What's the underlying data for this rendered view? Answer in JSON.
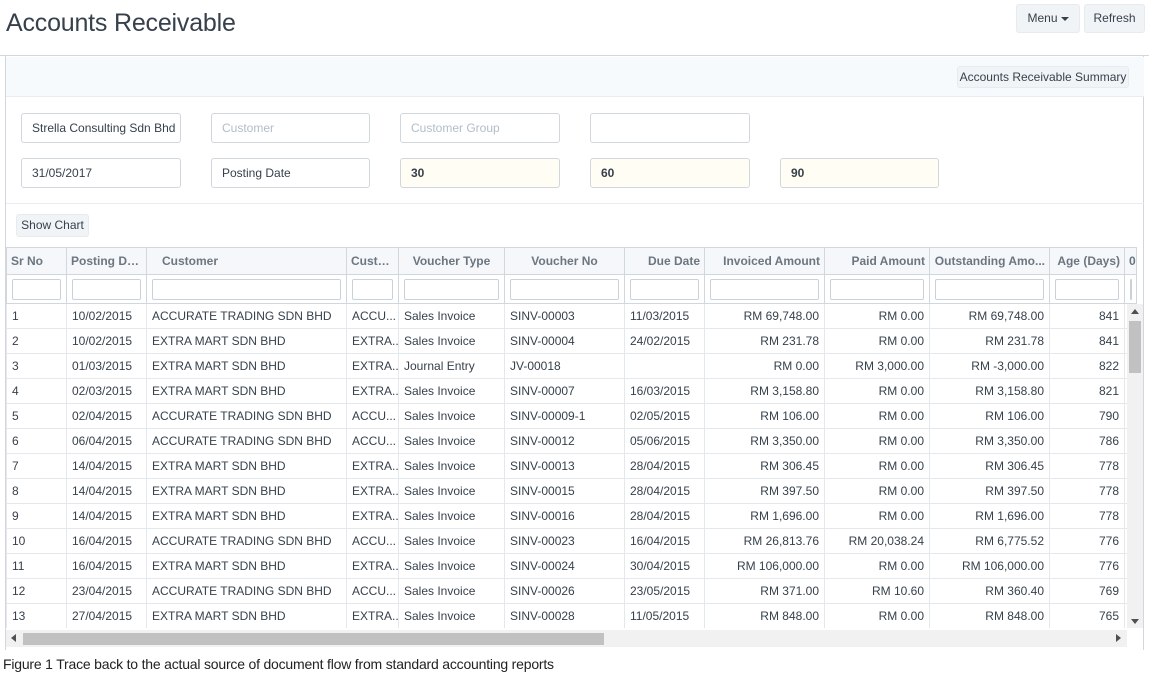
{
  "header": {
    "title": "Accounts Receivable",
    "menu_label": "Menu",
    "refresh_label": "Refresh"
  },
  "toolbar": {
    "summary_label": "Accounts Receivable Summary",
    "show_chart_label": "Show Chart"
  },
  "filters": {
    "company": "Strella Consulting Sdn Bhd",
    "customer_placeholder": "Customer",
    "customer_group_placeholder": "Customer Group",
    "date": "31/05/2017",
    "posting_date": "Posting Date",
    "range1": "30",
    "range2": "60",
    "range3": "90"
  },
  "columns": [
    "Sr No",
    "Posting Da...",
    "Customer",
    "Custo...",
    "Voucher Type",
    "Voucher No",
    "Due Date",
    "Invoiced Amount",
    "Paid Amount",
    "Outstanding Amo...",
    "Age (Days)",
    "0"
  ],
  "rows": [
    [
      "1",
      "10/02/2015",
      "ACCURATE TRADING SDN BHD",
      "ACCU...",
      "Sales Invoice",
      "SINV-00003",
      "11/03/2015",
      "RM 69,748.00",
      "RM 0.00",
      "RM 69,748.00",
      "841"
    ],
    [
      "2",
      "10/02/2015",
      "EXTRA MART SDN BHD",
      "EXTRA...",
      "Sales Invoice",
      "SINV-00004",
      "24/02/2015",
      "RM 231.78",
      "RM 0.00",
      "RM 231.78",
      "841"
    ],
    [
      "3",
      "01/03/2015",
      "EXTRA MART SDN BHD",
      "EXTRA...",
      "Journal Entry",
      "JV-00018",
      "",
      "RM 0.00",
      "RM 3,000.00",
      "RM -3,000.00",
      "822"
    ],
    [
      "4",
      "02/03/2015",
      "EXTRA MART SDN BHD",
      "EXTRA...",
      "Sales Invoice",
      "SINV-00007",
      "16/03/2015",
      "RM 3,158.80",
      "RM 0.00",
      "RM 3,158.80",
      "821"
    ],
    [
      "5",
      "02/04/2015",
      "ACCURATE TRADING SDN BHD",
      "ACCU...",
      "Sales Invoice",
      "SINV-00009-1",
      "02/05/2015",
      "RM 106.00",
      "RM 0.00",
      "RM 106.00",
      "790"
    ],
    [
      "6",
      "06/04/2015",
      "ACCURATE TRADING SDN BHD",
      "ACCU...",
      "Sales Invoice",
      "SINV-00012",
      "05/06/2015",
      "RM 3,350.00",
      "RM 0.00",
      "RM 3,350.00",
      "786"
    ],
    [
      "7",
      "14/04/2015",
      "EXTRA MART SDN BHD",
      "EXTRA...",
      "Sales Invoice",
      "SINV-00013",
      "28/04/2015",
      "RM 306.45",
      "RM 0.00",
      "RM 306.45",
      "778"
    ],
    [
      "8",
      "14/04/2015",
      "EXTRA MART SDN BHD",
      "EXTRA...",
      "Sales Invoice",
      "SINV-00015",
      "28/04/2015",
      "RM 397.50",
      "RM 0.00",
      "RM 397.50",
      "778"
    ],
    [
      "9",
      "14/04/2015",
      "EXTRA MART SDN BHD",
      "EXTRA...",
      "Sales Invoice",
      "SINV-00016",
      "28/04/2015",
      "RM 1,696.00",
      "RM 0.00",
      "RM 1,696.00",
      "778"
    ],
    [
      "10",
      "16/04/2015",
      "ACCURATE TRADING SDN BHD",
      "ACCU...",
      "Sales Invoice",
      "SINV-00023",
      "16/04/2015",
      "RM 26,813.76",
      "RM 20,038.24",
      "RM 6,775.52",
      "776"
    ],
    [
      "11",
      "16/04/2015",
      "EXTRA MART SDN BHD",
      "EXTRA...",
      "Sales Invoice",
      "SINV-00024",
      "30/04/2015",
      "RM 106,000.00",
      "RM 0.00",
      "RM 106,000.00",
      "776"
    ],
    [
      "12",
      "23/04/2015",
      "ACCURATE TRADING SDN BHD",
      "ACCU...",
      "Sales Invoice",
      "SINV-00026",
      "23/05/2015",
      "RM 371.00",
      "RM 10.60",
      "RM 360.40",
      "769"
    ],
    [
      "13",
      "27/04/2015",
      "EXTRA MART SDN BHD",
      "EXTRA...",
      "Sales Invoice",
      "SINV-00028",
      "11/05/2015",
      "RM 848.00",
      "RM 0.00",
      "RM 848.00",
      "765"
    ]
  ],
  "caption": "Figure 1 Trace back to the actual source of document flow from standard accounting reports"
}
